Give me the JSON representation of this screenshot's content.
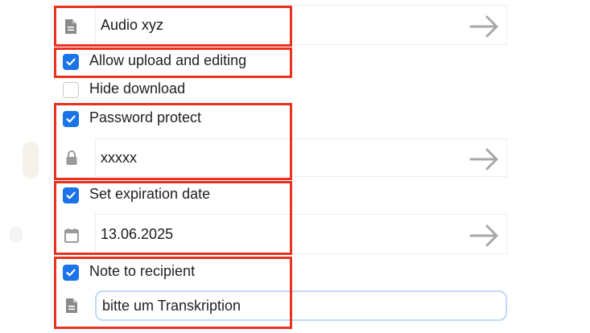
{
  "share_form": {
    "label_field": {
      "value": "Audio xyz",
      "icon": "file-icon"
    },
    "allow_upload": {
      "label": "Allow upload and editing",
      "checked": true
    },
    "hide_download": {
      "label": "Hide download",
      "checked": false
    },
    "password_protect": {
      "label": "Password protect",
      "checked": true,
      "value": "xxxxx",
      "icon": "lock-icon"
    },
    "expiration": {
      "label": "Set expiration date",
      "checked": true,
      "value": "13.06.2025",
      "icon": "calendar-icon"
    },
    "note": {
      "label": "Note to recipient",
      "checked": true,
      "value": "bitte um Transkription",
      "icon": "file-icon"
    }
  },
  "colors": {
    "checkbox": "#1a73e8",
    "highlight": "#e8311f",
    "focus_border": "#c2d9f6"
  }
}
